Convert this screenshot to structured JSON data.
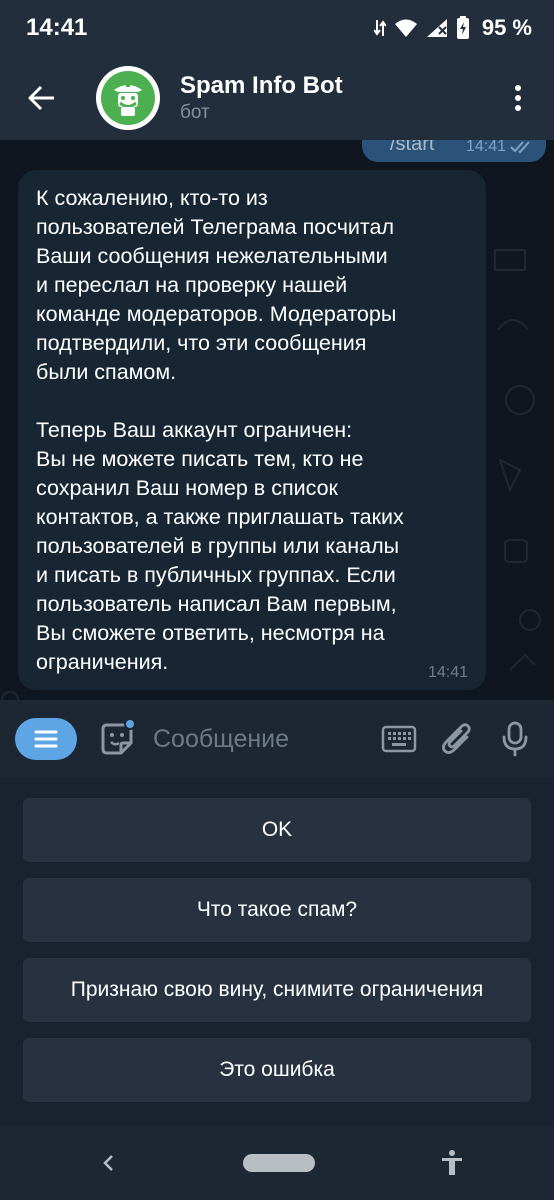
{
  "status_bar": {
    "time": "14:41",
    "battery": "95 %"
  },
  "header": {
    "title": "Spam Info Bot",
    "subtitle": "бот"
  },
  "outgoing": {
    "text": "/start",
    "time": "14:41"
  },
  "incoming": {
    "paragraph1": "К сожалению, кто-то из\nпользователей Телеграма посчитал\nВаши сообщения нежелательными\nи переслал на проверку нашей\nкоманде модераторов. Модераторы\nподтвердили, что эти сообщения\nбыли спамом.",
    "paragraph2": "Теперь Ваш аккаунт ограничен:\nВы не можете писать тем, кто не\nсохранил Ваш номер в список\nконтактов, а также приглашать таких\nпользователей в группы или каналы\nи писать в публичных группах. Если\nпользователь написал Вам первым,\nВы сможете ответить, несмотря на\nограничения.",
    "time": "14:41"
  },
  "composer": {
    "placeholder": "Сообщение"
  },
  "keyboard": {
    "buttons": [
      "OK",
      "Что такое спам?",
      "Признаю свою вину, снимите ограничения",
      "Это ошибка"
    ]
  },
  "colors": {
    "accent": "#5ea5e6",
    "background": "#17212b",
    "bot_avatar": "#4caf50",
    "outgoing_bubble": "#2b5278",
    "incoming_bubble": "#182533"
  },
  "icons": [
    "back-arrow-icon",
    "bot-avatar-icon",
    "more-vert-icon",
    "menu-icon",
    "sticker-icon",
    "keyboard-icon",
    "attach-icon",
    "mic-icon",
    "nav-back-icon",
    "accessibility-icon"
  ]
}
